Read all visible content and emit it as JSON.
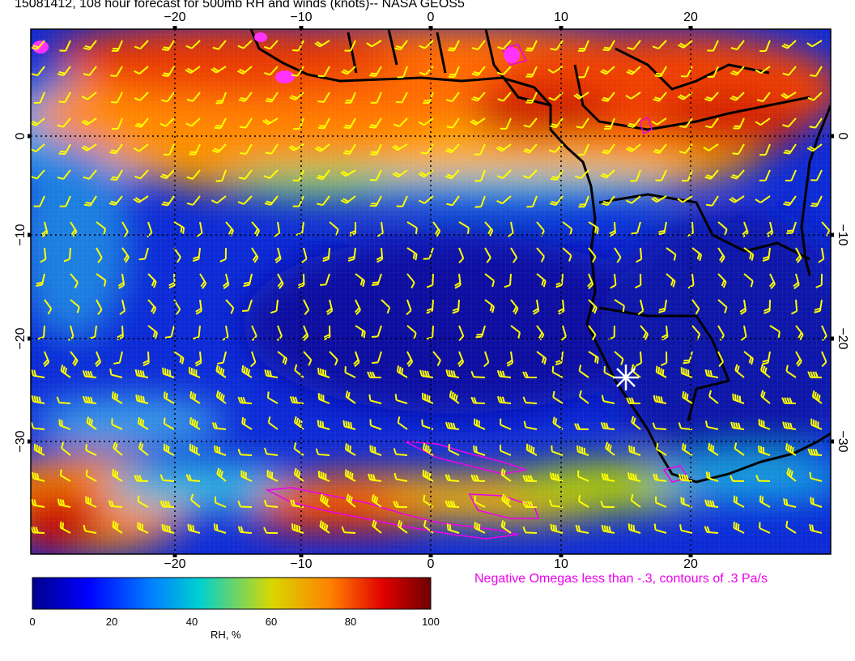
{
  "title": "15081412, 108 hour forecast for 500mb RH and winds (knots)-- NASA GEOS5",
  "map": {
    "lon_range": [
      -30,
      30
    ],
    "lat_range": [
      -39,
      10
    ],
    "lon_ticks": [
      "−20",
      "−10",
      "0",
      "10",
      "20"
    ],
    "lat_ticks": [
      "0",
      "−10",
      "−20",
      "−30"
    ],
    "gridlines": "dotted",
    "marker_icon": "white-star-icon",
    "barb_color": "#ffff00",
    "omega_color": "#ee00ee",
    "coast_color": "#000000"
  },
  "colorbar": {
    "label": "RH, %",
    "ticks": [
      "0",
      "20",
      "40",
      "60",
      "80",
      "100"
    ],
    "range": [
      0,
      100
    ],
    "colors": [
      "#00008c",
      "#0000ff",
      "#0080ff",
      "#00d0d0",
      "#d8d800",
      "#ff8000",
      "#e00000",
      "#6e0000"
    ]
  },
  "omega_caption": "Negative Omegas less than -.3, contours of .3 Pa/s"
}
